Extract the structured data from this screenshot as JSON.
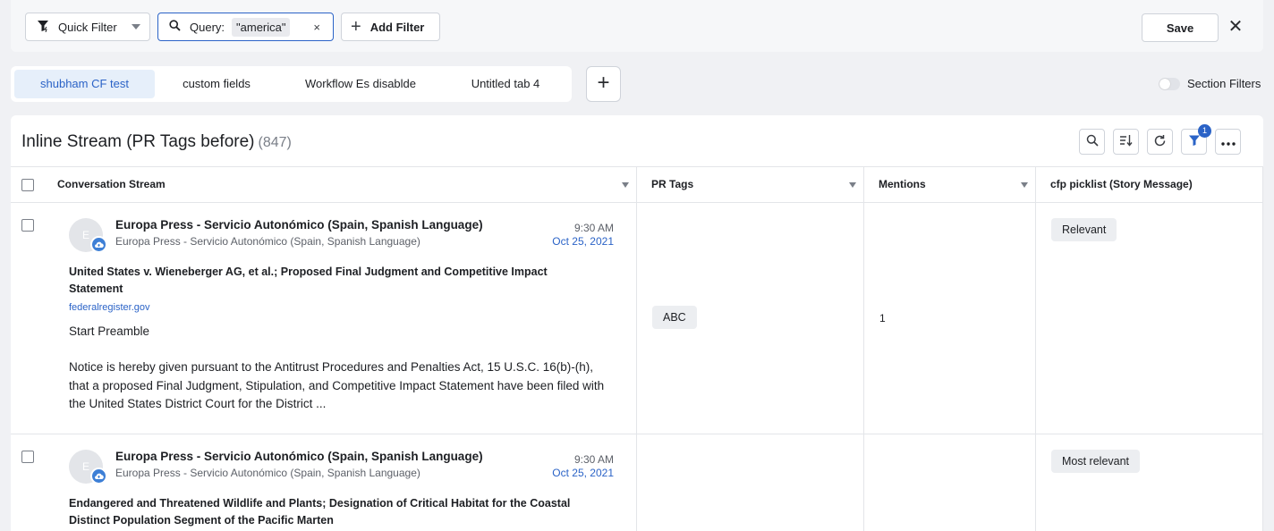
{
  "filterbar": {
    "quick_filter_label": "Quick Filter",
    "query_label": "Query:",
    "query_value": "\"america\"",
    "query_clear": "×",
    "add_filter_label": "Add Filter",
    "save_label": "Save",
    "close_label": "✕"
  },
  "tabs": [
    {
      "label": "shubham CF test",
      "active": true
    },
    {
      "label": "custom fields",
      "active": false
    },
    {
      "label": "Workflow Es disablde",
      "active": false
    },
    {
      "label": "Untitled tab 4",
      "active": false
    }
  ],
  "add_tab_label": "+",
  "section_filters_label": "Section Filters",
  "stream": {
    "title": "Inline Stream (PR Tags before)",
    "count": "(847)",
    "filter_badge": "1",
    "columns": [
      "Conversation Stream",
      "PR Tags",
      "Mentions",
      "cfp picklist (Story Message)"
    ],
    "rows": [
      {
        "avatar_letter": "E",
        "source": "Europa Press - Servicio Autonómico (Spain, Spanish Language)",
        "source_sub": "Europa Press - Servicio Autonómico (Spain, Spanish Language)",
        "time": "9:30 AM",
        "date": "Oct 25, 2021",
        "headline": "United States v. Wieneberger AG, et al.; Proposed Final Judgment and Competitive Impact Statement",
        "domain": "federalregister.gov",
        "preamble": "Start Preamble",
        "body": "Notice is hereby given pursuant to the Antitrust Procedures and Penalties Act, 15 U.S.C. 16(b)-(h), that a proposed Final Judgment, Stipulation, and Competitive Impact Statement have been filed with the United States District Court for the District ...",
        "pr_tag": "ABC",
        "mentions": "1",
        "picklist": "Relevant"
      },
      {
        "avatar_letter": "E",
        "source": "Europa Press - Servicio Autonómico (Spain, Spanish Language)",
        "source_sub": "Europa Press - Servicio Autonómico (Spain, Spanish Language)",
        "time": "9:30 AM",
        "date": "Oct 25, 2021",
        "headline": "Endangered and Threatened Wildlife and Plants; Designation of Critical Habitat for the Coastal Distinct Population Segment of the Pacific Marten",
        "picklist": "Most relevant"
      }
    ]
  },
  "colors": {
    "accent": "#2b63c7",
    "tab_active_bg": "#e6effa",
    "avatar_badge": "#3d7fd6"
  }
}
